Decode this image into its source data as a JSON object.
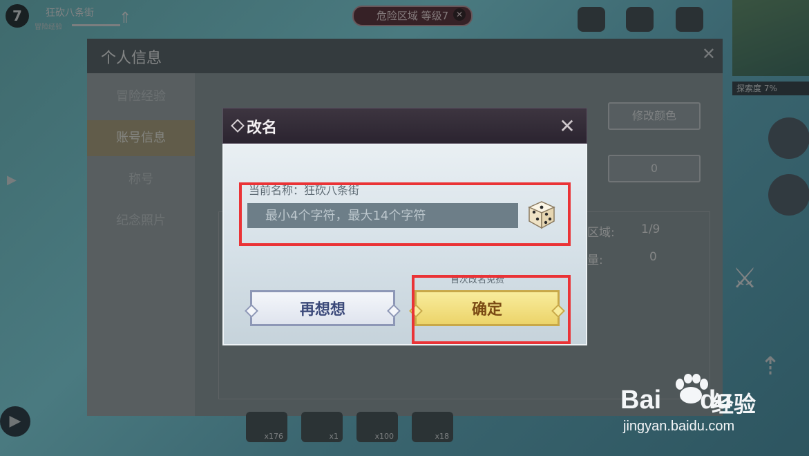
{
  "hud": {
    "level": "7",
    "player_name": "狂砍八条街",
    "exp_label": "冒险经验",
    "zone_label": "危险区域 等级7",
    "explore_label": "探索度 7%"
  },
  "panel": {
    "title": "个人信息",
    "tabs": [
      {
        "label": "冒险经验"
      },
      {
        "label": "账号信息"
      },
      {
        "label": "称号"
      },
      {
        "label": "纪念照片"
      }
    ],
    "avatar_name": "狂砍八条街",
    "change_color_label": "修改颜色",
    "likes_value": "0",
    "region_label": "区域:",
    "region_value": "1/9",
    "count_label": "量:",
    "count_value": "0"
  },
  "bottom_bar": {
    "items": [
      {
        "count": "x176"
      },
      {
        "count": "x1"
      },
      {
        "count": "x100"
      },
      {
        "count": "x18"
      }
    ]
  },
  "modal": {
    "title": "改名",
    "current_name_label": "当前名称：狂砍八条街",
    "input_placeholder": "最小4个字符，最大14个字符",
    "input_value": "",
    "free_note": "首次改名免费",
    "cancel_label": "再想想",
    "confirm_label": "确定",
    "close_icon": "close-icon",
    "random_icon": "dice-icon"
  },
  "highlight_color": "#ea3336",
  "watermark": {
    "logo": "Bai",
    "logo_du": "du",
    "cn": "经验",
    "url": "jingyan.baidu.com"
  }
}
